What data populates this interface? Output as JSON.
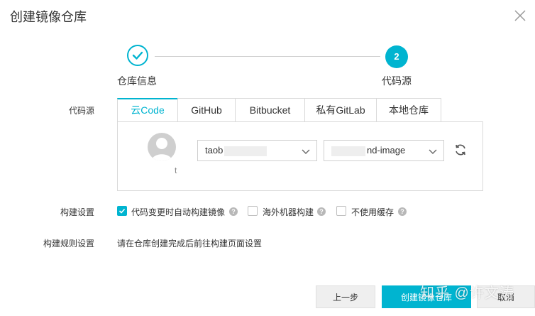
{
  "dialog": {
    "title": "创建镜像仓库",
    "close_icon": "close-icon"
  },
  "steps": [
    {
      "label": "仓库信息",
      "status": "done",
      "icon": "check-icon"
    },
    {
      "label": "代码源",
      "number": "2",
      "status": "active"
    }
  ],
  "code_source": {
    "label": "代码源",
    "tabs": [
      "云Code",
      "GitHub",
      "Bitbucket",
      "私有GitLab",
      "本地仓库"
    ],
    "active_tab": "云Code",
    "avatar_caption": "t",
    "namespace_select": {
      "value": "taob"
    },
    "repo_select": {
      "value": "nd-image"
    },
    "refresh_icon": "refresh-icon"
  },
  "build_settings": {
    "label": "构建设置",
    "options": [
      {
        "label": "代码变更时自动构建镜像",
        "checked": true
      },
      {
        "label": "海外机器构建",
        "checked": false
      },
      {
        "label": "不使用缓存",
        "checked": false
      }
    ],
    "help_icon": "help-icon"
  },
  "build_rules": {
    "label": "构建规则设置",
    "hint": "请在仓库创建完成后前往构建页面设置"
  },
  "footer": {
    "prev_label": "上一步",
    "create_label": "创建镜像仓库",
    "cancel_label": "取消"
  },
  "watermark": "知乎 @许文涛",
  "colors": {
    "accent": "#00b4d0"
  }
}
